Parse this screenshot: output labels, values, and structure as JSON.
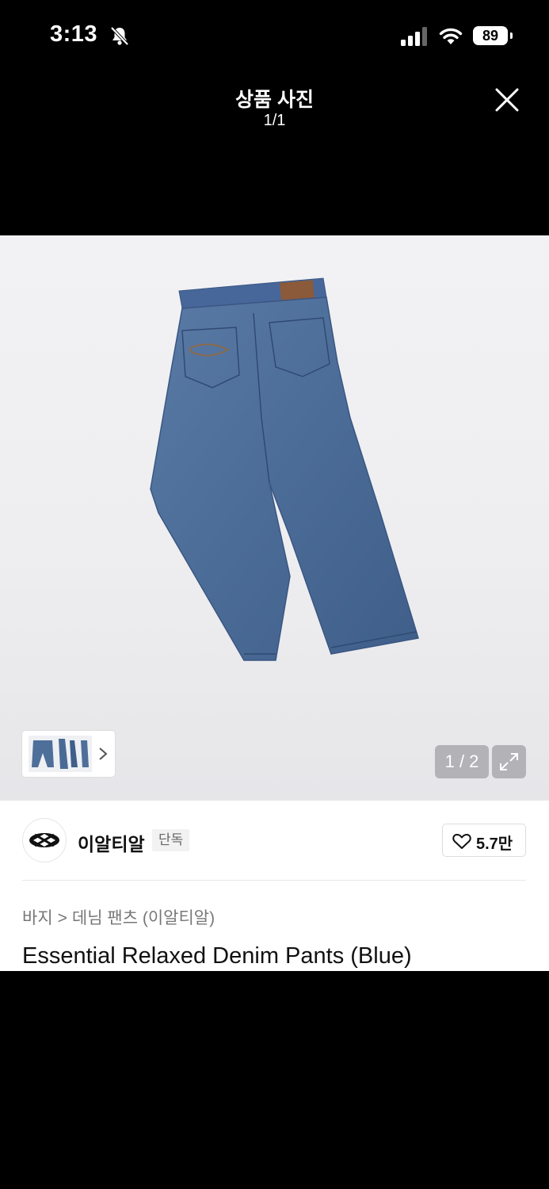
{
  "status_bar": {
    "time": "3:13",
    "battery": "89",
    "icons": [
      "bell-slash-icon",
      "signal-icon",
      "wifi-icon",
      "battery-icon"
    ]
  },
  "header": {
    "title": "상품 사진",
    "counter": "1/1",
    "close_icon": "close-icon"
  },
  "gallery": {
    "page_indicator": "1 / 2",
    "expand_icon": "expand-icon",
    "thumbnail_chevron_icon": "chevron-right-icon"
  },
  "brand": {
    "name": "이알티알",
    "badge": "단독",
    "likes": "5.7만"
  },
  "breadcrumb": {
    "category": "바지",
    "subcategory": "데님 팬츠 (이알티알)"
  },
  "product": {
    "title": "Essential Relaxed Denim Pants (Blue)"
  },
  "colors": {
    "denim": "#4e6f9a",
    "background_image": "#eeeef0"
  }
}
